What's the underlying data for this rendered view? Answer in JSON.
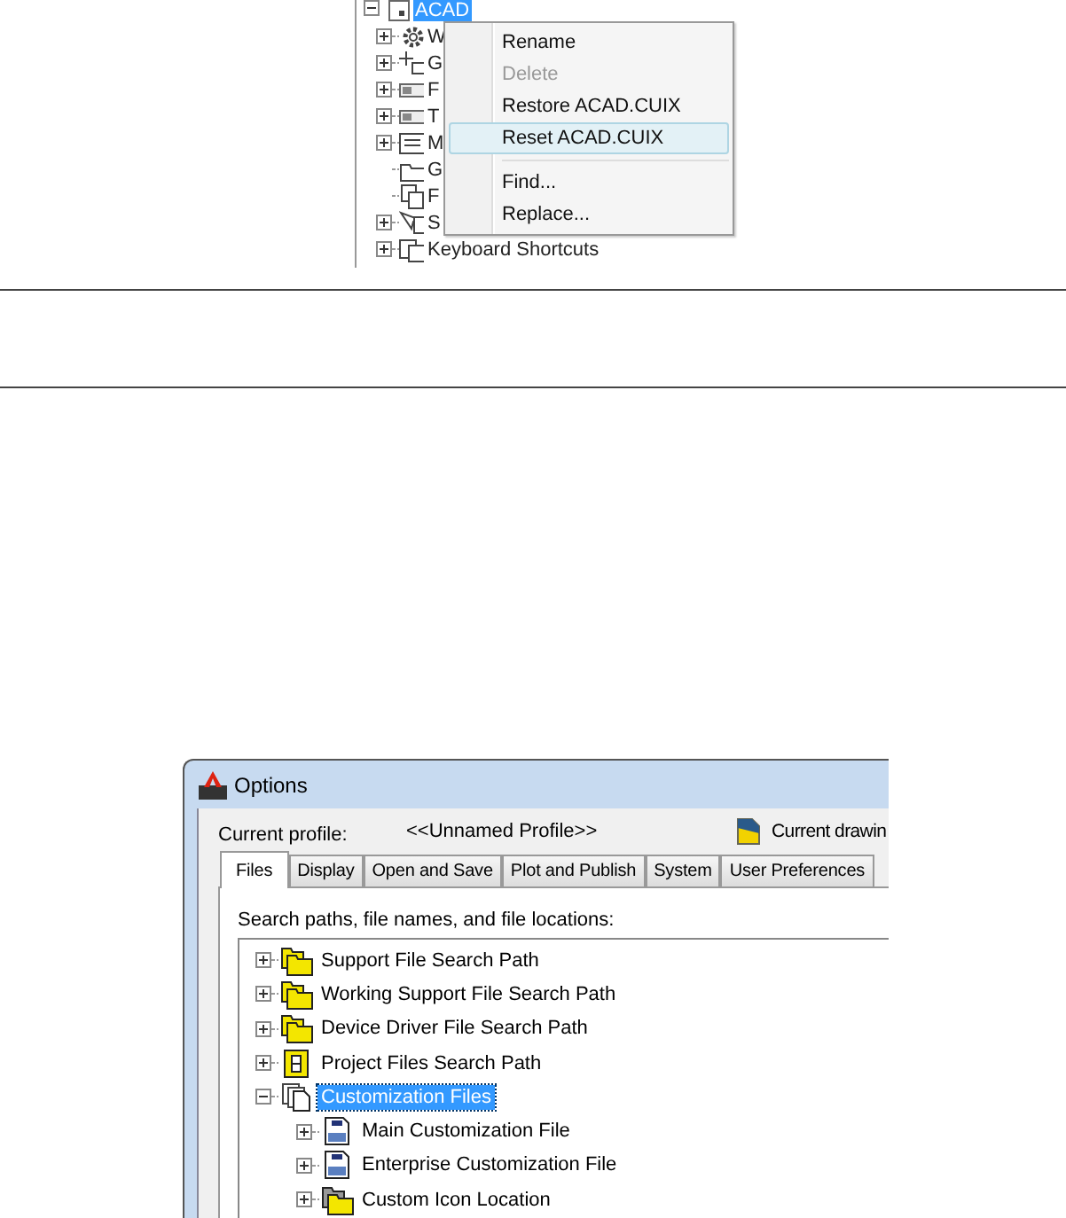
{
  "cui_tree": {
    "root": {
      "label": "ACAD",
      "selected": true,
      "expanded": true
    },
    "children": [
      {
        "label": "W",
        "expandable": true,
        "kind": "gear"
      },
      {
        "label": "G",
        "expandable": true,
        "kind": "tool"
      },
      {
        "label": "F",
        "expandable": true,
        "kind": "bar"
      },
      {
        "label": "T",
        "expandable": true,
        "kind": "bar"
      },
      {
        "label": "M",
        "expandable": true,
        "kind": "menu"
      },
      {
        "label": "G",
        "expandable": false,
        "kind": "folder"
      },
      {
        "label": "F",
        "expandable": false,
        "kind": "doc"
      },
      {
        "label": "S",
        "expandable": true,
        "kind": "cursor"
      },
      {
        "label": "Keyboard Shortcuts",
        "expandable": true,
        "kind": "key"
      }
    ]
  },
  "context_menu": {
    "items": [
      {
        "kind": "item",
        "label": "Rename",
        "disabled": false,
        "selected": false
      },
      {
        "kind": "item",
        "label": "Delete",
        "disabled": true,
        "selected": false
      },
      {
        "kind": "item",
        "label": "Restore ACAD.CUIX",
        "disabled": false,
        "selected": false
      },
      {
        "kind": "item",
        "label": "Reset ACAD.CUIX",
        "disabled": false,
        "selected": true
      },
      {
        "kind": "separator"
      },
      {
        "kind": "item",
        "label": "Find...",
        "disabled": false,
        "selected": false
      },
      {
        "kind": "item",
        "label": "Replace...",
        "disabled": false,
        "selected": false
      }
    ]
  },
  "options_window": {
    "title": "Options",
    "profile_label": "Current profile:",
    "profile_value": "<<Unnamed Profile>>",
    "drawing_label": "Current drawin",
    "tabs": [
      {
        "label": "Files",
        "selected": true
      },
      {
        "label": "Display",
        "selected": false
      },
      {
        "label": "Open and Save",
        "selected": false
      },
      {
        "label": "Plot and Publish",
        "selected": false
      },
      {
        "label": "System",
        "selected": false
      },
      {
        "label": "User Preferences",
        "selected": false
      }
    ],
    "list_label": "Search paths, file names, and file locations:",
    "tree": [
      {
        "label": "Support File Search Path",
        "kind": "folders",
        "expanded": false,
        "selected": false
      },
      {
        "label": "Working Support File Search Path",
        "kind": "folders",
        "expanded": false,
        "selected": false
      },
      {
        "label": "Device Driver File Search Path",
        "kind": "folders",
        "expanded": false,
        "selected": false
      },
      {
        "label": "Project Files Search Path",
        "kind": "project",
        "expanded": false,
        "selected": false
      },
      {
        "label": "Customization Files",
        "kind": "documents",
        "expanded": true,
        "selected": true,
        "children": [
          {
            "label": "Main Customization File",
            "kind": "cui",
            "expanded": false,
            "selected": false
          },
          {
            "label": "Enterprise Customization File",
            "kind": "cui",
            "expanded": false,
            "selected": false
          },
          {
            "label": "Custom Icon Location",
            "kind": "grayfolders",
            "expanded": false,
            "selected": false
          }
        ]
      }
    ]
  }
}
